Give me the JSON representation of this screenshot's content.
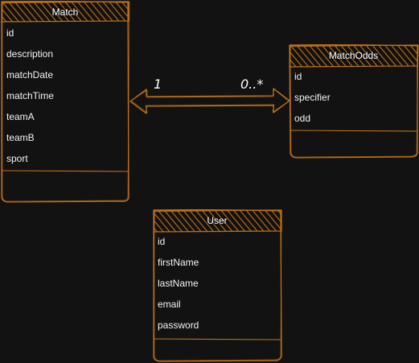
{
  "entities": {
    "match": {
      "title": "Match",
      "fields": [
        "id",
        "description",
        "matchDate",
        "matchTime",
        "teamA",
        "teamB",
        "sport"
      ]
    },
    "match_odds": {
      "title": "MatchOdds",
      "fields": [
        "id",
        "specifier",
        "odd"
      ]
    },
    "user": {
      "title": "User",
      "fields": [
        "id",
        "firstName",
        "lastName",
        "email",
        "password"
      ]
    }
  },
  "relation": {
    "left_label": "1",
    "right_label": "0..*"
  },
  "colors": {
    "background": "#121212",
    "stroke": "#c0721a",
    "header_hatch": "#c0721a",
    "text": "#f0f0f0"
  }
}
